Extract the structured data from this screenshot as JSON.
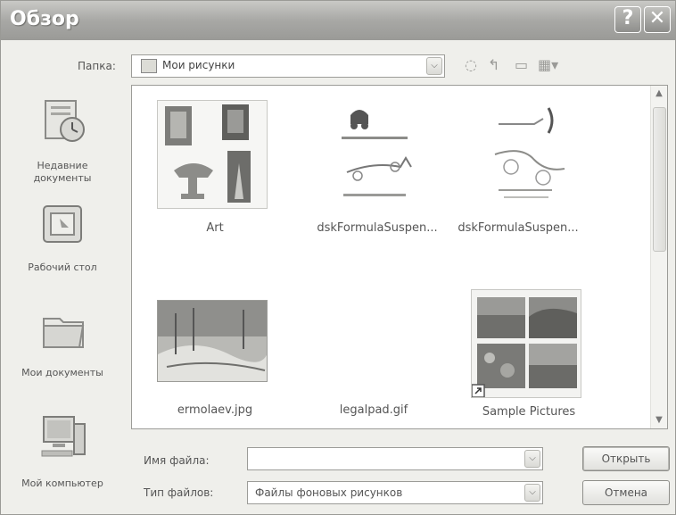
{
  "window": {
    "title": "Обзор",
    "help_glyph": "?",
    "close_glyph": "✕"
  },
  "toolbar": {
    "lookin_label": "Папка:",
    "lookin_value": "Мои рисунки",
    "dropdown_glyph": "⌵",
    "back_glyph": "◌",
    "up_glyph": "↰",
    "newfolder_glyph": "▭",
    "views_glyph": "▦▾"
  },
  "places": [
    {
      "label": "Недавние документы",
      "icon": "recent-documents-icon"
    },
    {
      "label": "Рабочий стол",
      "icon": "desktop-icon"
    },
    {
      "label": "Мои документы",
      "icon": "my-documents-icon"
    },
    {
      "label": "Мой компьютер",
      "icon": "my-computer-icon"
    }
  ],
  "files": [
    {
      "name": "Art",
      "kind": "folder"
    },
    {
      "name": "dskFormulaSuspen...",
      "kind": "image"
    },
    {
      "name": "dskFormulaSuspen...",
      "kind": "image"
    },
    {
      "name": "ermolaev.jpg",
      "kind": "image"
    },
    {
      "name": "legalpad.gif",
      "kind": "image"
    },
    {
      "name": "Sample Pictures",
      "kind": "folder-shortcut"
    }
  ],
  "bottom": {
    "filename_label": "Имя файла:",
    "filename_value": "",
    "filetype_label": "Тип файлов:",
    "filetype_value": "Файлы фоновых рисунков",
    "open_label": "Открыть",
    "cancel_label": "Отмена"
  },
  "colors": {
    "titlebar": "#a8a8a5",
    "window_bg": "#efefeb",
    "list_bg": "#ffffff"
  }
}
